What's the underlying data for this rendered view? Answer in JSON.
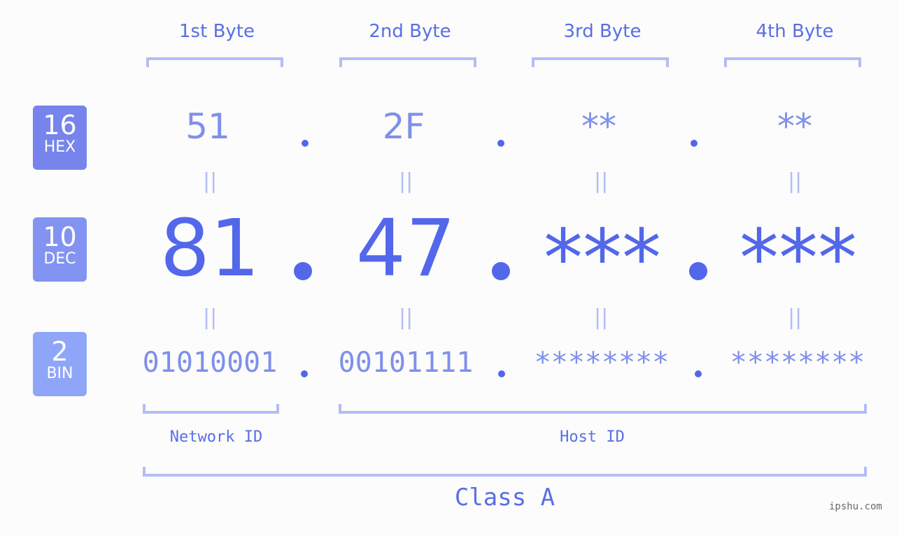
{
  "bytes": [
    {
      "header": "1st Byte",
      "hex": "51",
      "dec": "81",
      "bin": "01010001"
    },
    {
      "header": "2nd Byte",
      "hex": "2F",
      "dec": "47",
      "bin": "00101111"
    },
    {
      "header": "3rd Byte",
      "hex": "**",
      "dec": "***",
      "bin": "********"
    },
    {
      "header": "4th Byte",
      "hex": "**",
      "dec": "***",
      "bin": "********"
    }
  ],
  "bases": {
    "hex": {
      "number": "16",
      "label": "HEX",
      "color": "#7784ec"
    },
    "dec": {
      "number": "10",
      "label": "DEC",
      "color": "#8393f2"
    },
    "bin": {
      "number": "2",
      "label": "BIN",
      "color": "#8fa5f8"
    }
  },
  "equals_symbol": "||",
  "network_label": "Network ID",
  "host_label": "Host ID",
  "class_label": "Class A",
  "watermark": "ipshu.com",
  "colors": {
    "accent": "#5367ea",
    "light_accent": "#7f8fea",
    "bracket": "#b3bdf5",
    "background": "#fbfcfb"
  }
}
